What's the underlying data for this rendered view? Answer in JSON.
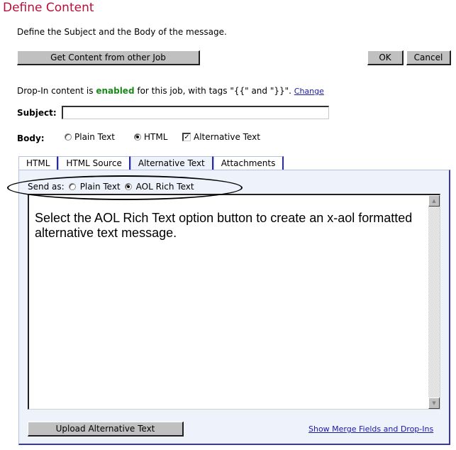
{
  "page": {
    "title": "Define Content",
    "intro": "Define the Subject and the Body of the message."
  },
  "toolbar": {
    "get_content_label": "Get Content from other Job",
    "ok_label": "OK",
    "cancel_label": "Cancel"
  },
  "dropin": {
    "prefix": "Drop-In content is ",
    "status": "enabled",
    "suffix": " for this job, with tags \"{{\" and \"}}\". ",
    "change_link": "Change",
    "status_color": "#1a8a1a"
  },
  "subject": {
    "label": "Subject:",
    "value": "",
    "placeholder": ""
  },
  "body": {
    "label": "Body:",
    "options": [
      {
        "label": "Plain Text",
        "type": "radio",
        "checked": false
      },
      {
        "label": "HTML",
        "type": "radio",
        "checked": true
      },
      {
        "label": "Alternative Text",
        "type": "checkbox",
        "checked": true
      }
    ]
  },
  "tabs": [
    {
      "label": "HTML",
      "active": false
    },
    {
      "label": "HTML Source",
      "active": false
    },
    {
      "label": "Alternative Text",
      "active": true
    },
    {
      "label": "Attachments",
      "active": false
    }
  ],
  "send_as": {
    "label": "Send as:",
    "options": [
      {
        "label": "Plain Text",
        "checked": false
      },
      {
        "label": "AOL Rich Text",
        "checked": true
      }
    ]
  },
  "editor": {
    "content": "Select the AOL Rich Text option button to create an x-aol formatted alternative text message.",
    "scroll_up_icon": "▲",
    "scroll_down_icon": "▼"
  },
  "footer": {
    "upload_label": "Upload Alternative Text",
    "merge_link": "Show Merge Fields and Drop-Ins"
  },
  "colors": {
    "title": "#b5103c",
    "link": "#1a1aa6",
    "panel_bg": "#eef2fb",
    "tab_border": "#2a2aa0"
  }
}
